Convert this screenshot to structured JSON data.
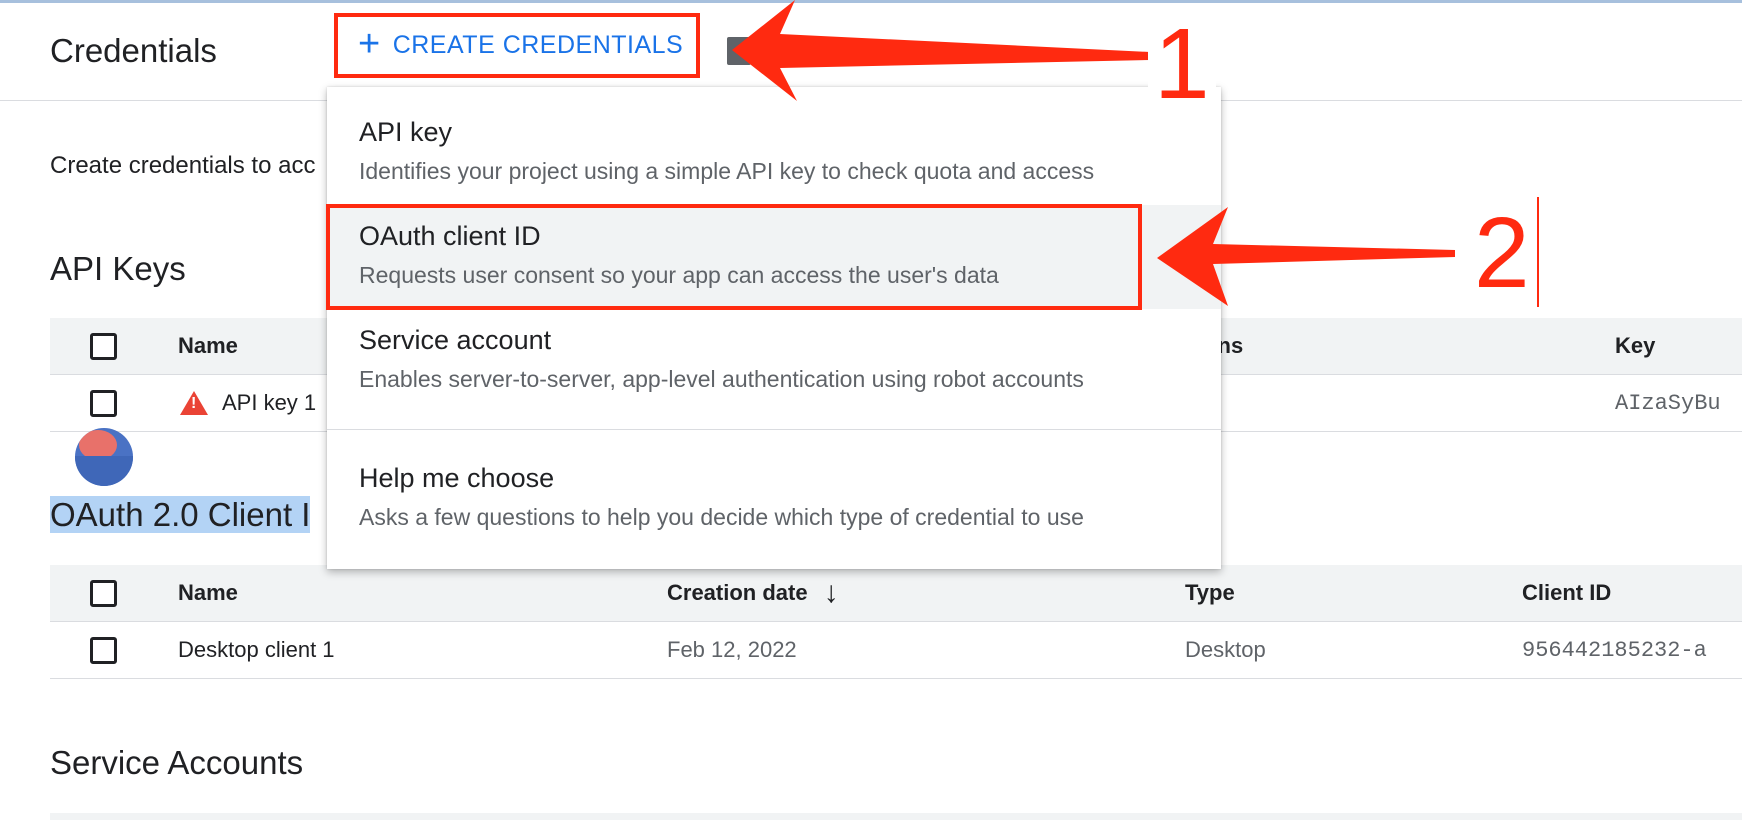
{
  "header": {
    "title": "Credentials",
    "create_label": "CREATE CREDENTIALS"
  },
  "intro_text": "Create credentials to acc",
  "api_keys": {
    "title": "API Keys",
    "columns": [
      "Name",
      "ions",
      "Key"
    ],
    "rows": [
      {
        "name": "API key 1",
        "key": "AIzaSyBu"
      }
    ]
  },
  "oauth": {
    "title": "OAuth 2.0 Client I",
    "columns": [
      "Name",
      "Creation date",
      "Type",
      "Client ID"
    ],
    "rows": [
      {
        "name": "Desktop client 1",
        "date": "Feb 12, 2022",
        "type": "Desktop",
        "client_id": "956442185232-a"
      }
    ]
  },
  "service_accounts": {
    "title": "Service Accounts"
  },
  "menu": {
    "items": [
      {
        "title": "API key",
        "desc": "Identifies your project using a simple API key to check quota and access"
      },
      {
        "title": "OAuth client ID",
        "desc": "Requests user consent so your app can access the user's data"
      },
      {
        "title": "Service account",
        "desc": "Enables server-to-server, app-level authentication using robot accounts"
      },
      {
        "title": "Help me choose",
        "desc": "Asks a few questions to help you decide which type of credential to use"
      }
    ]
  },
  "annotations": {
    "step1": "1",
    "step2": "2",
    "color": "#ff2a10"
  },
  "icons": [
    "plus-icon",
    "warning-icon",
    "sort-down-arrow-icon",
    "avatar"
  ]
}
